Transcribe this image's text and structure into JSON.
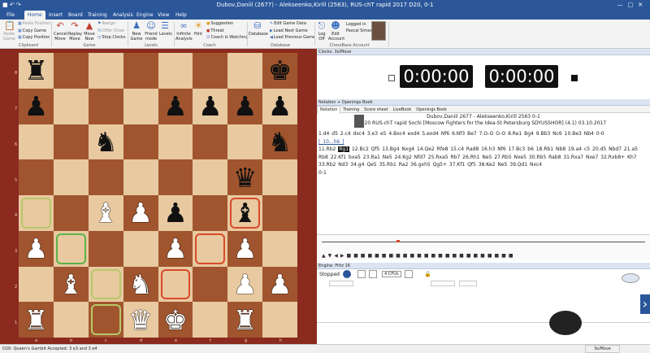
{
  "window": {
    "title": "Dubov,Daniil (2677) - Alekseenko,Kirill (2563), RUS-chT rapid 2017  D20, 0-1"
  },
  "tabs": [
    "File",
    "Home",
    "Insert",
    "Board",
    "Training",
    "Analysis",
    "Engine",
    "View",
    "Help"
  ],
  "ribbon": {
    "clipboard": {
      "paste_game": "Paste Game",
      "paste_position": "Paste Position",
      "copy_game": "Copy Game",
      "copy_position": "Copy Position",
      "label": "Clipboard"
    },
    "game": {
      "cancel_move": "Cancel Move",
      "replay_move": "Replay Move",
      "move_now": "Move Now",
      "resign": "Resign",
      "offer_draw": "Offer Draw",
      "stop_clocks": "Stop Clocks",
      "label": "Game"
    },
    "levels": {
      "new_game": "New Game",
      "friend_mode": "Friend mode",
      "levels": "Levels",
      "label": "Levels"
    },
    "coach": {
      "infinite_analysis": "Infinite Analysis",
      "hint": "Hint",
      "suggestion": "Suggestion",
      "threat": "Threat",
      "coach_watching": "Coach Is Watching",
      "label": "Coach"
    },
    "database": {
      "database": "Database",
      "edit_game_data": "Edit Game Data",
      "load_next_game": "Load Next Game",
      "load_previous_game": "Load Previous Game",
      "label": "Database"
    },
    "account": {
      "log_off": "Log Off",
      "edit_account": "Edit Account",
      "logged_in": "Logged in",
      "user": "Pascal Simon",
      "label": "ChessBase Account"
    }
  },
  "board": {
    "ranks": [
      "8",
      "7",
      "6",
      "5",
      "4",
      "3",
      "2",
      "1"
    ],
    "files": [
      "a",
      "b",
      "c",
      "d",
      "e",
      "f",
      "g",
      "h"
    ],
    "rows": [
      [
        "",
        "",
        "",
        "",
        "",
        "",
        "",
        "",
        ""
      ],
      [
        "",
        "",
        "",
        "",
        "",
        "",
        "",
        "",
        ""
      ],
      [
        "",
        "",
        "",
        "",
        "",
        "",
        "",
        "",
        ""
      ],
      [
        "",
        "",
        "",
        "",
        "",
        "",
        "",
        "",
        ""
      ],
      [
        "",
        "",
        "",
        "",
        "",
        "",
        "",
        "",
        ""
      ],
      [
        "",
        "",
        "",
        "",
        "",
        "",
        "",
        "",
        ""
      ],
      [
        "",
        "",
        "",
        "",
        "",
        "",
        "",
        "",
        ""
      ],
      [
        "",
        "",
        "",
        "",
        "",
        "",
        "",
        "",
        ""
      ]
    ]
  },
  "clocks": {
    "header": "Clocks: 3s/Move",
    "white": "0:00:00",
    "black": "0:00:00"
  },
  "notation": {
    "header": "Notation + Openings Book",
    "tabs": [
      "Notation",
      "Training",
      "Score sheet",
      "LiveBook",
      "Openings Book"
    ],
    "players": "Dubov,Daniil 2677 - Alekseenko,Kirill 2563  0-1",
    "event": "D20 RUS-chT rapid Sochi [Moscow Fighters for the Idea-St Petersburg SDYUSSHOR] (4.1) 03.10.2017",
    "line1": "1.d4  d5  2.c4  dxc4  3.e3  e5  4.Bxc4  exd4  5.exd4  Nf6  6.Nf3  Be7  7.O-O  O-O  8.Re1  Bg4  9.Bb3  Nc6  10.Be3  Nb4  0-0",
    "variation": "[ 10...h6 ]",
    "cur_pre": "11.Rb2",
    "cur_move": "Rg1",
    "line2": "12.Bc2  Qf5  13.Bg4  Nxg4  14.Qe2  Rfe8  15.c4  Rad8  16.h3  Nf6  17.Bc3  b6  18.Rb1  Nb8  19.a4  c5  20.d5  Nbd7  21.a5  Rb8  22.Kf1  bxa5  23.Ra1  Ne5  24.Kg2  Nfd7  25.Rxa5  Rb7  26.Rh1  Ne5  27.Rb5  Nxe5  30.Rb5  Rab8  31.Rxa7  Nxe7  32.Rxb8+  Kh7  33.Rb2  Nd3  34.g4  Qe5  35.Rb1  Ra2  36.gxh5  Qg5+  37.Kf1  Qf5  38.Ke2  Ne5  39.Qd1  Nxc4",
    "result": "0-1"
  },
  "engine": {
    "header": "Engine: Fritz 16",
    "status": "Stopped",
    "cpus": "4 CPUs"
  },
  "statusbar": {
    "opening": "D20: Queen's Gambit Accepted: 3 e3 and 3 e4",
    "fps": "3s/Move"
  }
}
